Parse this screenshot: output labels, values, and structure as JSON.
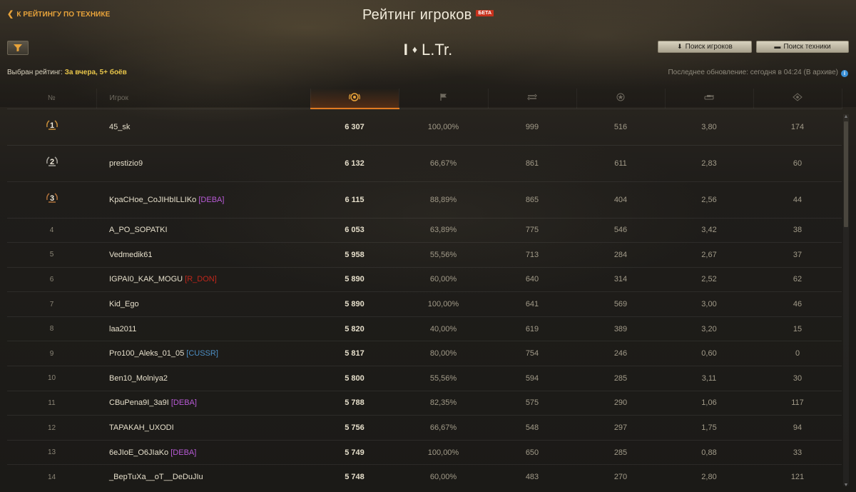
{
  "header": {
    "back_link": "К РЕЙТИНГУ ПО ТЕХНИКЕ",
    "title": "Рейтинг игроков",
    "beta_badge": "БЕТА"
  },
  "tank": {
    "tier": "I",
    "name": "L.Tr."
  },
  "buttons": {
    "search_players": "Поиск игроков",
    "search_tech": "Поиск техники"
  },
  "selected_rating": {
    "label": "Выбран рейтинг:",
    "value": "За вчера, 5+ боёв"
  },
  "last_update": "Последнее обновление: сегодня в 04:24 (В архиве)",
  "table": {
    "headers": {
      "rank": "№",
      "player": "Игрок"
    },
    "header_icons": [
      "rating-icon",
      "flag-icon",
      "damage-icon",
      "xp-star-icon",
      "tank-kills-icon",
      "spotted-icon"
    ],
    "rows": [
      {
        "rank": "1",
        "player": "45_sk",
        "clan": "",
        "rating": "6 307",
        "winrate": "100,00%",
        "damage": "999",
        "xp": "516",
        "kills": "3,80",
        "spotted": "174"
      },
      {
        "rank": "2",
        "player": "prestizio9",
        "clan": "",
        "rating": "6 132",
        "winrate": "66,67%",
        "damage": "861",
        "xp": "611",
        "kills": "2,83",
        "spotted": "60"
      },
      {
        "rank": "3",
        "player": "KpaCHoe_CoJIHbILLIKo",
        "clan": "[DEBA]",
        "rating": "6 115",
        "winrate": "88,89%",
        "damage": "865",
        "xp": "404",
        "kills": "2,56",
        "spotted": "44"
      },
      {
        "rank": "4",
        "player": "A_PO_SOPATKI",
        "clan": "",
        "rating": "6 053",
        "winrate": "63,89%",
        "damage": "775",
        "xp": "546",
        "kills": "3,42",
        "spotted": "38"
      },
      {
        "rank": "5",
        "player": "Vedmedik61",
        "clan": "",
        "rating": "5 958",
        "winrate": "55,56%",
        "damage": "713",
        "xp": "284",
        "kills": "2,67",
        "spotted": "37"
      },
      {
        "rank": "6",
        "player": "IGPAI0_KAK_MOGU",
        "clan": "[R_DON]",
        "rating": "5 890",
        "winrate": "60,00%",
        "damage": "640",
        "xp": "314",
        "kills": "2,52",
        "spotted": "62"
      },
      {
        "rank": "7",
        "player": "Kid_Ego",
        "clan": "",
        "rating": "5 890",
        "winrate": "100,00%",
        "damage": "641",
        "xp": "569",
        "kills": "3,00",
        "spotted": "46"
      },
      {
        "rank": "8",
        "player": "laa2011",
        "clan": "",
        "rating": "5 820",
        "winrate": "40,00%",
        "damage": "619",
        "xp": "389",
        "kills": "3,20",
        "spotted": "15"
      },
      {
        "rank": "9",
        "player": "Pro100_Aleks_01_05",
        "clan": "[CUSSR]",
        "rating": "5 817",
        "winrate": "80,00%",
        "damage": "754",
        "xp": "246",
        "kills": "0,60",
        "spotted": "0"
      },
      {
        "rank": "10",
        "player": "Ben10_Molniya2",
        "clan": "",
        "rating": "5 800",
        "winrate": "55,56%",
        "damage": "594",
        "xp": "285",
        "kills": "3,11",
        "spotted": "30"
      },
      {
        "rank": "11",
        "player": "CBuPena9I_3a9I",
        "clan": "[DEBA]",
        "rating": "5 788",
        "winrate": "82,35%",
        "damage": "575",
        "xp": "290",
        "kills": "1,06",
        "spotted": "117"
      },
      {
        "rank": "12",
        "player": "TAPAKAH_UXODI",
        "clan": "",
        "rating": "5 756",
        "winrate": "66,67%",
        "damage": "548",
        "xp": "297",
        "kills": "1,75",
        "spotted": "94"
      },
      {
        "rank": "13",
        "player": "6eJIoE_O6JIaKo",
        "clan": "[DEBA]",
        "rating": "5 749",
        "winrate": "100,00%",
        "damage": "650",
        "xp": "285",
        "kills": "0,88",
        "spotted": "33"
      },
      {
        "rank": "14",
        "player": "_BepTuXa__oT__DeDuJIu",
        "clan": "",
        "rating": "5 748",
        "winrate": "60,00%",
        "damage": "483",
        "xp": "270",
        "kills": "2,80",
        "spotted": "121"
      }
    ]
  },
  "colors": {
    "accent_orange": "#e8a33a",
    "rating_yellow": "#e8c54a",
    "beta_red": "#c8321d",
    "clan_deba": "#b85ad6",
    "clan_rdon": "#c0261b",
    "clan_cussr": "#4d8fc4"
  }
}
